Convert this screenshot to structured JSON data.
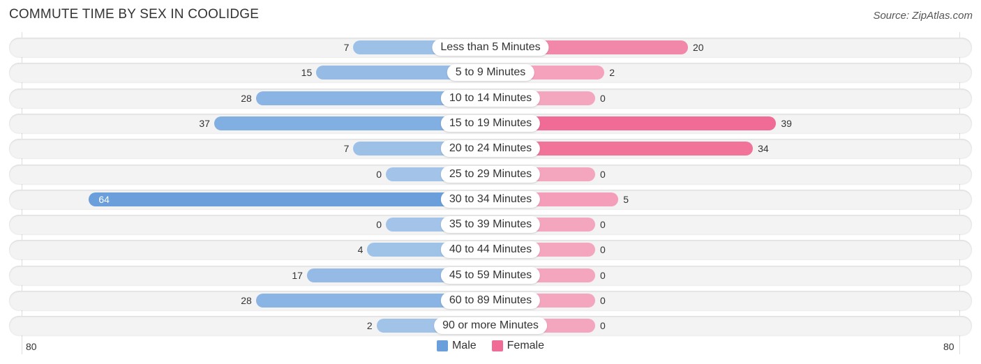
{
  "title": "COMMUTE TIME BY SEX IN COOLIDGE",
  "source": "Source: ZipAtlas.com",
  "colors": {
    "male": "#6a9fdc",
    "male_light": "#a3c4e8",
    "female": "#f06b95",
    "female_light": "#f5a6bf"
  },
  "chart_data": {
    "type": "bar",
    "orientation": "horizontal-diverging",
    "title": "COMMUTE TIME BY SEX IN COOLIDGE",
    "categories": [
      "Less than 5 Minutes",
      "5 to 9 Minutes",
      "10 to 14 Minutes",
      "15 to 19 Minutes",
      "20 to 24 Minutes",
      "25 to 29 Minutes",
      "30 to 34 Minutes",
      "35 to 39 Minutes",
      "40 to 44 Minutes",
      "45 to 59 Minutes",
      "60 to 89 Minutes",
      "90 or more Minutes"
    ],
    "series": [
      {
        "name": "Male",
        "values": [
          7,
          15,
          28,
          37,
          7,
          0,
          64,
          0,
          4,
          17,
          28,
          2
        ]
      },
      {
        "name": "Female",
        "values": [
          20,
          2,
          0,
          39,
          34,
          0,
          5,
          0,
          0,
          0,
          0,
          0
        ]
      }
    ],
    "axis": {
      "left_tick": "80",
      "right_tick": "80",
      "range": [
        0,
        80
      ]
    },
    "legend": {
      "position": "bottom-center",
      "items": [
        "Male",
        "Female"
      ]
    },
    "grid": false
  }
}
